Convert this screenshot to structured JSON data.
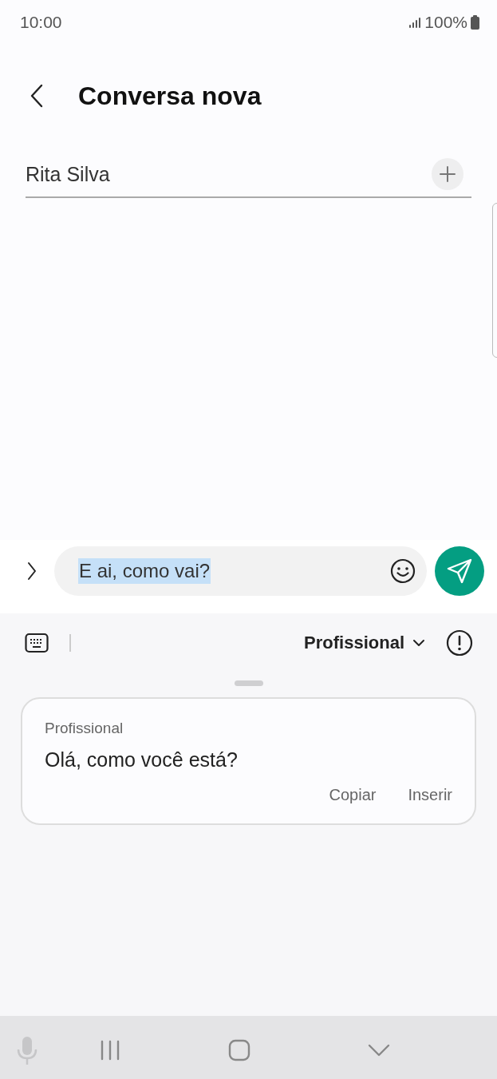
{
  "status_bar": {
    "time": "10:00",
    "battery": "100%"
  },
  "header": {
    "title": "Conversa nova"
  },
  "recipient": {
    "value": "Rita Silva"
  },
  "composer": {
    "value": "E ai, como vai?",
    "text_selected": true
  },
  "tone_bar": {
    "tone": "Profissional"
  },
  "suggestion": {
    "label": "Profissional",
    "text": "Olá, como você está?",
    "actions": [
      "Copiar",
      "Inserir"
    ]
  }
}
